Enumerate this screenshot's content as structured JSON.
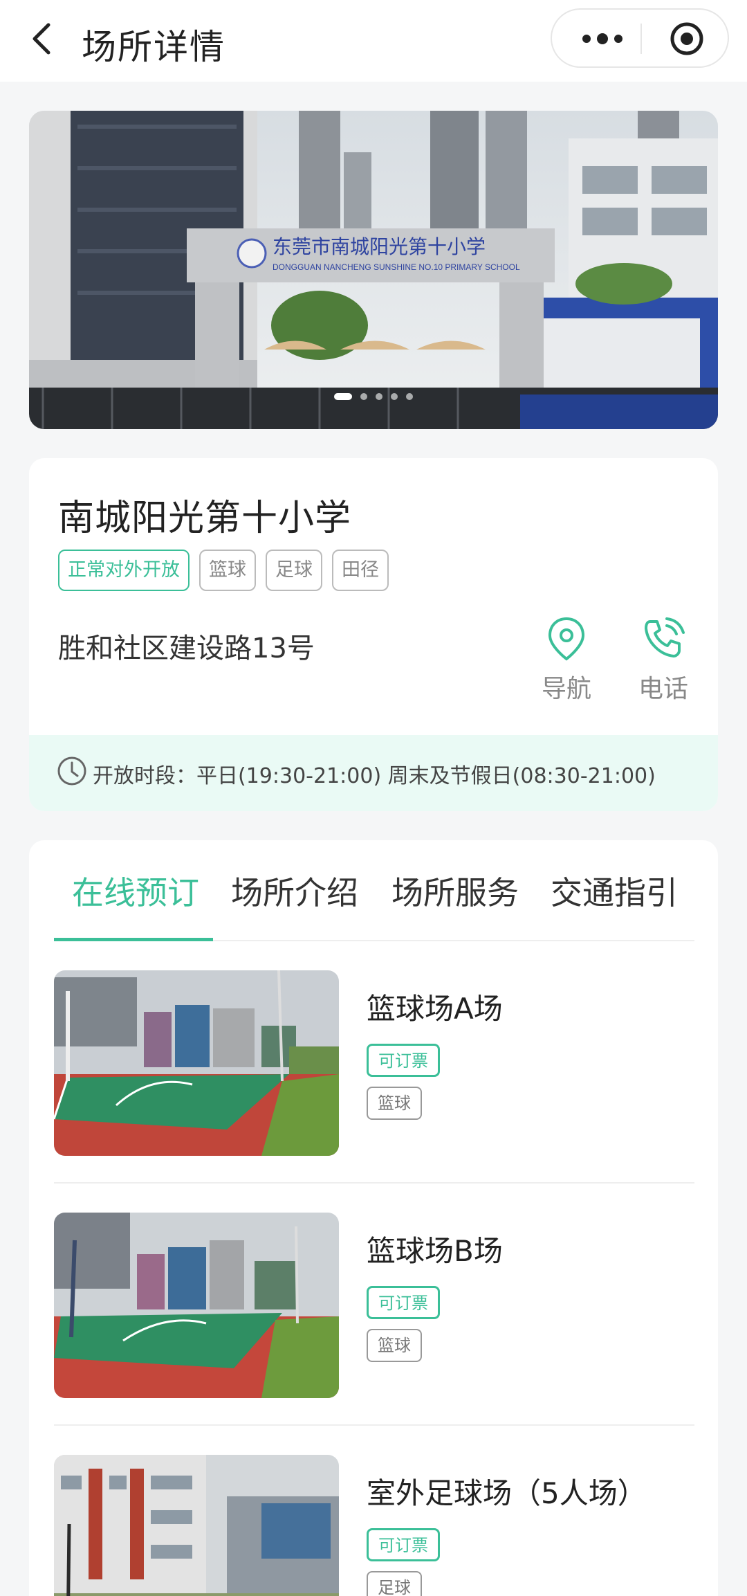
{
  "header": {
    "title": "场所详情"
  },
  "venue": {
    "name": "南城阳光第十小学",
    "tags": [
      "正常对外开放",
      "篮球",
      "足球",
      "田径"
    ],
    "address": "胜和社区建设路13号",
    "actions": {
      "navigate": "导航",
      "phone": "电话"
    },
    "hours": "开放时段：平日(19:30-21:00) 周末及节假日(08:30-21:00)"
  },
  "banner": {
    "school_sign_cn": "东莞市南城阳光第十小学",
    "school_sign_en": "DONGGUAN NANCHENG SUNSHINE NO.10 PRIMARY SCHOOL",
    "dots": 5,
    "active_dot": 0
  },
  "tabs": [
    "在线预订",
    "场所介绍",
    "场所服务",
    "交通指引"
  ],
  "active_tab": 0,
  "facilities": [
    {
      "name": "篮球场A场",
      "status": "可订票",
      "sport": "篮球"
    },
    {
      "name": "篮球场B场",
      "status": "可订票",
      "sport": "篮球"
    },
    {
      "name": "室外足球场（5人场）",
      "status": "可订票",
      "sport": "足球"
    }
  ],
  "colors": {
    "accent": "#3bbf98",
    "hours_bg": "#eafaf5"
  }
}
